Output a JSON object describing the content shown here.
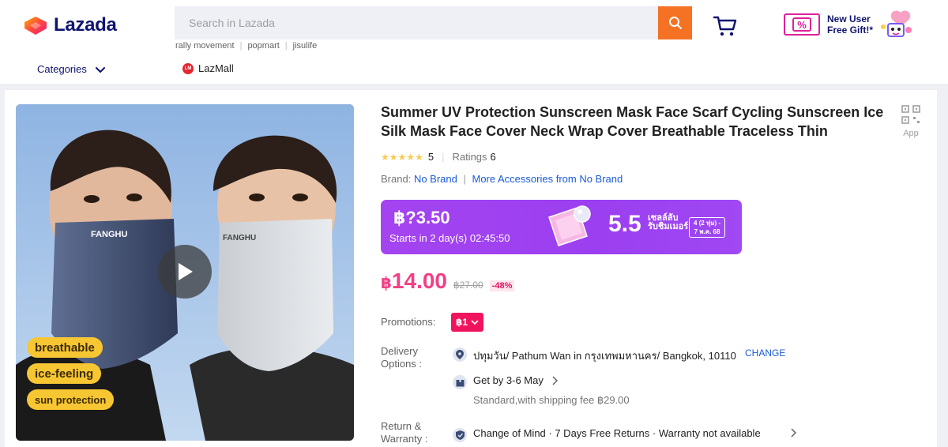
{
  "header": {
    "logo_text": "Lazada",
    "search": {
      "placeholder": "Search in Lazada"
    },
    "suggestions": [
      "rally movement",
      "popmart",
      "jisulife"
    ],
    "promo": {
      "badge": "%",
      "line1": "New User",
      "line2": "Free Gift!*"
    },
    "categories_label": "Categories",
    "lazmall": {
      "icon_text": "LM",
      "label": "LazMall"
    }
  },
  "product": {
    "media": {
      "brand_print_left": "FANGHU",
      "brand_print_right": "FANGHU",
      "tags": [
        "breathable",
        "ice-feeling",
        "sun protection"
      ]
    },
    "title": "Summer UV Protection Sunscreen Mask Face Scarf Cycling Sunscreen Ice Silk Mask Face Cover Neck Wrap Cover Breathable Traceless Thin",
    "app_label": "App",
    "rating": {
      "score": "5",
      "ratings_label": "Ratings",
      "ratings_count": "6",
      "stars": 5
    },
    "brand": {
      "label": "Brand:",
      "value": "No Brand",
      "more": "More Accessories from No Brand"
    },
    "flash_sale": {
      "price": "฿?3.50",
      "timer": "Starts in 2 day(s) 02:45:50",
      "event": "5.5",
      "event_sub1": "เซลล์ลับ",
      "event_sub2": "รับชิมเมอร์",
      "date_line1": "4 (2 ทุ่ม) -",
      "date_line2": "7 พ.ค. 68"
    },
    "price": {
      "currency": "฿",
      "amount": "14.00",
      "original": "฿27.00",
      "discount": "-48%"
    },
    "promotions": {
      "label": "Promotions:",
      "voucher": "฿1"
    },
    "delivery": {
      "label": "Delivery Options :",
      "address": "ปทุมวัน/ Pathum Wan in กรุงเทพมหานคร/ Bangkok, 10110",
      "change": "CHANGE",
      "get_by": "Get by 3-6 May",
      "shipping": "Standard,with shipping fee ฿29.00"
    },
    "returns": {
      "label": "Return & Warranty :",
      "text": "Change of Mind · 7 Days Free Returns · Warranty not available"
    }
  },
  "colors": {
    "brand_navy": "#0f146d",
    "search_button": "#f57224",
    "price_pink": "#f23f86",
    "flash_purple": "#9b3ff0",
    "link_blue": "#1a5ad8",
    "tag_yellow": "#f7c633"
  }
}
